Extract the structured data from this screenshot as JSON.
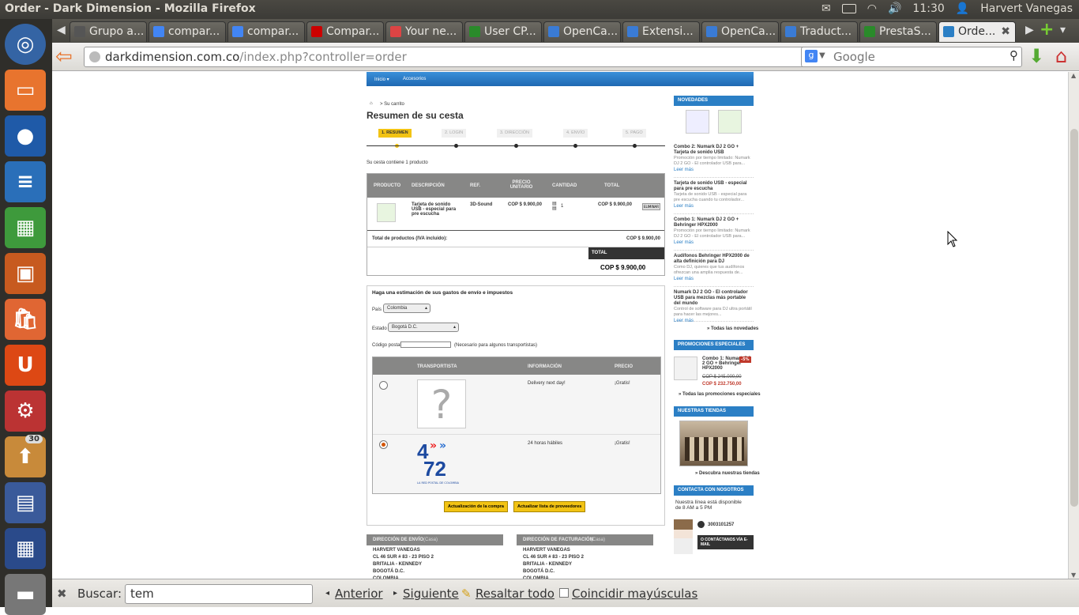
{
  "system": {
    "window_title": "Order - Dark Dimension - Mozilla Firefox",
    "clock": "11:30",
    "user": "Harvert Vanegas"
  },
  "launcher": {
    "workspace_badge": "30"
  },
  "tabs": [
    {
      "label": "Grupo a...",
      "color": "#555"
    },
    {
      "label": "compar...",
      "color": "#4285f4"
    },
    {
      "label": "compar...",
      "color": "#4285f4"
    },
    {
      "label": "Compar...",
      "color": "#cc0000"
    },
    {
      "label": "Your ne...",
      "color": "#d44"
    },
    {
      "label": "User CP...",
      "color": "#2a8a2a"
    },
    {
      "label": "OpenCa...",
      "color": "#3a7bd5"
    },
    {
      "label": "Extensi...",
      "color": "#3a7bd5"
    },
    {
      "label": "OpenCa...",
      "color": "#3a7bd5"
    },
    {
      "label": "Traduct...",
      "color": "#3a7bd5"
    },
    {
      "label": "PrestaS...",
      "color": "#2a8a2a"
    },
    {
      "label": "Orde...",
      "color": "#2b7fc5"
    }
  ],
  "navbar": {
    "url_host": "darkdimension.com.co",
    "url_path": "/index.php?controller=order",
    "search_placeholder": "Google"
  },
  "findbar": {
    "label": "Buscar:",
    "value": "tem",
    "prev": "Anterior",
    "next": "Siguiente",
    "highlight": "Resaltar todo",
    "match_case": "Coincidir mayúsculas"
  },
  "page": {
    "menu": [
      "Inicio ▾",
      "Accesorios"
    ],
    "breadcrumb": "Su carrito",
    "heading": "Resumen de su cesta",
    "steps": [
      "1. RESUMEN",
      "2. LOGIN",
      "3. DIRECCIÓN",
      "4. ENVÍO",
      "5. PAGO"
    ],
    "cart_count_text": "Su cesta contiene 1 producto",
    "table_headers": [
      "PRODUCTO",
      "DESCRIPCIÓN",
      "REF.",
      "PRECIO UNITARIO",
      "CANTIDAD",
      "TOTAL"
    ],
    "product": {
      "description": "Tarjeta de sonido USB - especial para pre escucha",
      "ref": "3D-Sound",
      "unit_price": "COP $ 9.900,00",
      "quantity": "1",
      "total": "COP $ 9.900,00",
      "delete_label": "ELIMINAR"
    },
    "total_products_label": "Total de productos (IVA incluido):",
    "total_products_value": "COP $ 9.900,00",
    "total_label": "TOTAL",
    "total_value": "COP $ 9.900,00",
    "shipping": {
      "title": "Haga una estimación de sus gastos de envío e impuestos",
      "country_label": "País",
      "country_value": "Colombia",
      "state_label": "Estado",
      "state_value": "Bogotá D.C.",
      "postcode_label": "Código postal",
      "postcode_note": "(Necesario para algunos transportistas)",
      "headers": [
        "TRANSPORTISTA",
        "INFORMACIÓN",
        "PRECIO"
      ],
      "carriers": [
        {
          "info": "Delivery next day!",
          "price": "¡Gratis!"
        },
        {
          "info": "24 horas hábiles",
          "price": "¡Gratis!",
          "logo_text": "LA RED POSTAL DE COLOMBIA"
        }
      ],
      "update_button": "Actualización de la compra",
      "update_carriers_button": "Actualizar lista de proveedores"
    },
    "address_shipping": {
      "title": "DIRECCIÓN DE ENVÍO",
      "tag": "(Casa)",
      "lines": [
        "HARVERT VANEGAS",
        "CL 46 SUR # 83 - 23 PISO 2",
        "BRITALIA - KENNEDY",
        "BOGOTÁ D.C.",
        "COLOMBIA"
      ]
    },
    "address_billing": {
      "title": "DIRECCIÓN DE FACTURACIÓN",
      "tag": "(Casa)",
      "lines": [
        "HARVERT VANEGAS",
        "CL 46 SUR # 83 - 23 PISO 2",
        "BRITALIA - KENNEDY",
        "BOGOTÁ D.C.",
        "COLOMBIA"
      ]
    }
  },
  "sidebar": {
    "novedades_title": "NOVEDADES",
    "news": [
      {
        "title": "Combo 2: Numark DJ 2 GO + Tarjeta de sonido USB",
        "desc": "Promoción por tiempo limitado: Numark DJ 2 GO - El controlador USB para...",
        "more": "Leer más"
      },
      {
        "title": "Tarjeta de sonido USB - especial para pre escucha",
        "desc": "Tarjeta de sonido USB - especial para pre escucha cuando tu controlador...",
        "more": "Leer más"
      },
      {
        "title": "Combo 1: Numark DJ 2 GO + Behringer HPX2000",
        "desc": "Promoción por tiempo limitado: Numark DJ 2 GO - El controlador USB para...",
        "more": "Leer más"
      },
      {
        "title": "Audífonos Behringer HPX2000 de alta definición para DJ",
        "desc": "Como DJ, quieres que tus audífonos ofrezcan una amplia respuesta de...",
        "more": "Leer más"
      },
      {
        "title": "Numark DJ 2 GO - El controlador USB para mezclas más portable del mundo",
        "desc": "Control de software para DJ ultra portátil para hacer las mejores...",
        "more": "Leer más"
      }
    ],
    "all_news": "» Todas las novedades",
    "promo_title": "PROMOCIONES ESPECIALES",
    "promo": {
      "name": "Combo 1: Numark DJ 2 GO + Behringer HPX2000",
      "badge": "-5%",
      "old_price": "COP $ 245.000,00",
      "new_price": "COP $ 232.750,00"
    },
    "all_promos": "» Todas las promociones especiales",
    "stores_title": "NUESTRAS TIENDAS",
    "stores_link": "» Descubra nuestras tiendas",
    "contact_title": "CONTACTA CON NOSOTROS",
    "contact_text": "Nuestra línea está disponible de 8 AM a 5 PM",
    "phone": "3003101257",
    "contact_button": "O CONTÁCTANOS VÍA E-MAIL"
  }
}
